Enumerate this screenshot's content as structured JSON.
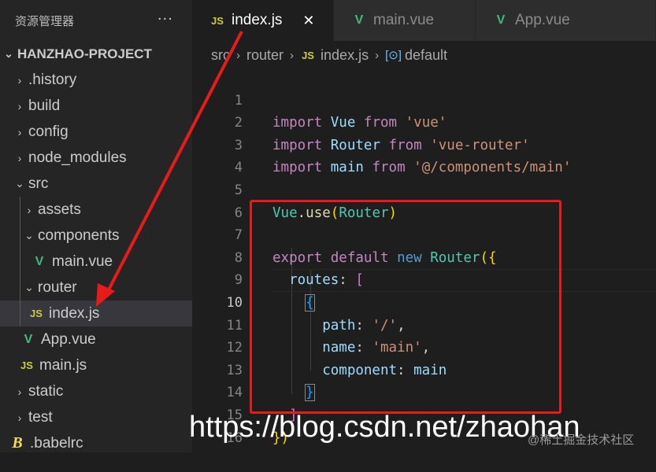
{
  "sidebar": {
    "title": "资源管理器",
    "more": "···",
    "project": "HANZHAO-PROJECT",
    "items": [
      {
        "label": ".history",
        "type": "folder"
      },
      {
        "label": "build",
        "type": "folder"
      },
      {
        "label": "config",
        "type": "folder"
      },
      {
        "label": "node_modules",
        "type": "folder"
      },
      {
        "label": "src",
        "type": "folder-open"
      },
      {
        "label": "assets",
        "type": "folder"
      },
      {
        "label": "components",
        "type": "folder-open"
      },
      {
        "label": "main.vue",
        "type": "vue"
      },
      {
        "label": "router",
        "type": "folder-open"
      },
      {
        "label": "index.js",
        "type": "js"
      },
      {
        "label": "App.vue",
        "type": "vue"
      },
      {
        "label": "main.js",
        "type": "js"
      },
      {
        "label": "static",
        "type": "folder"
      },
      {
        "label": "test",
        "type": "folder"
      },
      {
        "label": ".babelrc",
        "type": "babel"
      }
    ]
  },
  "tabs": [
    {
      "label": "index.js",
      "icon": "JS",
      "close": "✕"
    },
    {
      "label": "main.vue",
      "icon": "vue"
    },
    {
      "label": "App.vue",
      "icon": "vue"
    }
  ],
  "breadcrumb": {
    "src": "src",
    "router": "router",
    "file": "index.js",
    "symbol": "default",
    "js": "JS"
  },
  "icons": {
    "js": "JS",
    "vue": "V",
    "babel": "B"
  },
  "code": {
    "line_numbers": [
      "1",
      "2",
      "3",
      "4",
      "5",
      "6",
      "7",
      "8",
      "9",
      "10",
      "11",
      "12",
      "13",
      "14",
      "15",
      "16"
    ],
    "l1": {
      "a": "import",
      "b": "Vue",
      "c": "from",
      "d": "'vue'"
    },
    "l2": {
      "a": "import",
      "b": "Router",
      "c": "from",
      "d": "'vue-router'"
    },
    "l3": {
      "a": "import",
      "b": "main",
      "c": "from",
      "d": "'@/components/main'"
    },
    "l5": {
      "a": "Vue",
      "b": ".",
      "c": "use",
      "d": "(",
      "e": "Router",
      "f": ")"
    },
    "l7": {
      "a": "export",
      "b": "default",
      "c": "new",
      "d": "Router",
      "e": "({"
    },
    "l8": {
      "a": "routes",
      "b": ": ",
      "c": "["
    },
    "l9": {
      "a": "{"
    },
    "l10": {
      "a": "path",
      "b": ": ",
      "c": "'/'",
      "d": ","
    },
    "l11": {
      "a": "name",
      "b": ": ",
      "c": "'main'",
      "d": ","
    },
    "l12": {
      "a": "component",
      "b": ": ",
      "c": "main"
    },
    "l13": {
      "a": "}"
    },
    "l14": {
      "a": "]"
    },
    "l15": {
      "a": "})"
    }
  },
  "watermark": "https://blog.csdn.net/zhaohan",
  "watermark2": "@稀土掘金技术社区",
  "colors": {
    "highlight_box": "#e81b1b",
    "arrow": "#e81b1b"
  }
}
